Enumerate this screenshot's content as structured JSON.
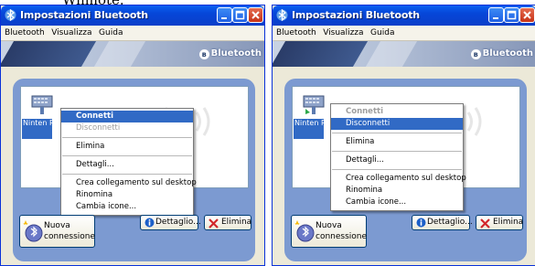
{
  "caption": "Wiimote.",
  "windows": [
    {
      "title": "Impostazioni Bluetooth",
      "menu": [
        "Bluetooth",
        "Visualizza",
        "Guida"
      ],
      "bluetooth_logo": "Bluetooth",
      "device_label": "Ninten RVL-CN",
      "context_menu": {
        "items": [
          {
            "label": "Connetti",
            "state": "highlighted-bold"
          },
          {
            "label": "Disconnetti",
            "state": "disabled"
          },
          {
            "label": "Elimina",
            "state": "normal"
          },
          {
            "label": "Dettagli...",
            "state": "normal"
          },
          {
            "label": "Crea collegamento sul desktop",
            "state": "normal"
          },
          {
            "label": "Rinomina",
            "state": "normal"
          },
          {
            "label": "Cambia icone...",
            "state": "normal"
          }
        ]
      },
      "buttons": {
        "new_connection_line1": "Nuova",
        "new_connection_line2": "connessione",
        "details": "Dettaglio...",
        "delete": "Elimina"
      }
    },
    {
      "title": "Impostazioni Bluetooth",
      "menu": [
        "Bluetooth",
        "Visualizza",
        "Guida"
      ],
      "bluetooth_logo": "Bluetooth",
      "device_label": "Ninten RVL-CN",
      "context_menu": {
        "items": [
          {
            "label": "Connetti",
            "state": "disabled-bold"
          },
          {
            "label": "Disconnetti",
            "state": "highlighted"
          },
          {
            "label": "Elimina",
            "state": "normal"
          },
          {
            "label": "Dettagli...",
            "state": "normal"
          },
          {
            "label": "Crea collegamento sul desktop",
            "state": "normal"
          },
          {
            "label": "Rinomina",
            "state": "normal"
          },
          {
            "label": "Cambia icone...",
            "state": "normal"
          }
        ]
      },
      "buttons": {
        "new_connection_line1": "Nuova",
        "new_connection_line2": "connessione",
        "details": "Dettaglio...",
        "delete": "Elimina"
      }
    }
  ],
  "colors": {
    "highlight": "#316ac5",
    "titlebar": "#0a5ff0",
    "panel": "#7c9ad1",
    "close": "#c63217"
  }
}
